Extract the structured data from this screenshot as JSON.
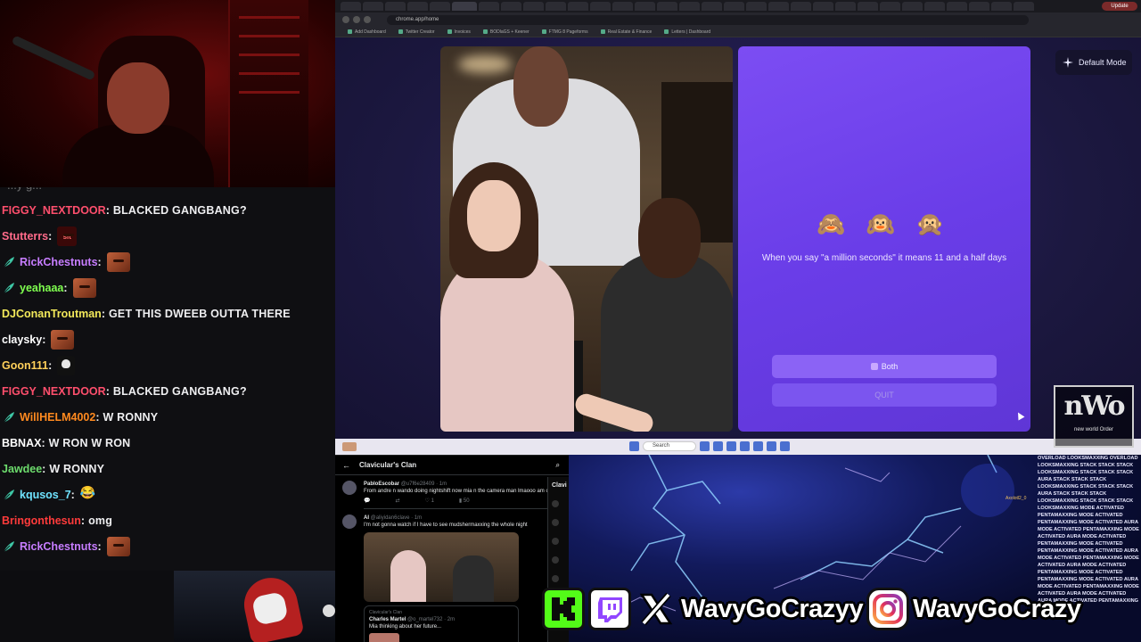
{
  "chat": {
    "cut_text": "...y g...",
    "messages": [
      {
        "user": "FIGGY_NEXTDOOR",
        "color": "#ff4f6d",
        "badge": "",
        "text": "BLACKED GANGBANG?",
        "emote": ""
      },
      {
        "user": "Stutterrs",
        "color": "#ff6b8a",
        "badge": "",
        "text": "",
        "emote": "sit"
      },
      {
        "user": "RickChestnuts",
        "color": "#c77dff",
        "badge": "feather",
        "text": "",
        "emote": "face"
      },
      {
        "user": "yeahaaa",
        "color": "#7fff4f",
        "badge": "feather",
        "text": "",
        "emote": "face"
      },
      {
        "user": "DJConanTroutman",
        "color": "#f2e85a",
        "badge": "",
        "text": "GET THIS DWEEB OUTTA THERE",
        "emote": ""
      },
      {
        "user": "claysky",
        "color": "#ffffff",
        "badge": "",
        "text": "",
        "emote": "face"
      },
      {
        "user": "Goon111",
        "color": "#ffd05a",
        "badge": "",
        "text": "",
        "emote": "skull"
      },
      {
        "user": "FIGGY_NEXTDOOR",
        "color": "#ff4f6d",
        "badge": "",
        "text": "BLACKED GANGBANG?",
        "emote": ""
      },
      {
        "user": "WillHELM4002",
        "color": "#ff8a1f",
        "badge": "feather",
        "text": "W RONNY",
        "emote": ""
      },
      {
        "user": "BBNAX",
        "color": "#ffffff",
        "badge": "",
        "text": "W RON W RON",
        "emote": ""
      },
      {
        "user": "Jawdee",
        "color": "#6ddc6d",
        "badge": "",
        "text": "W RONNY",
        "emote": ""
      },
      {
        "user": "kqusos_7",
        "color": "#6fe3ff",
        "badge": "feather",
        "text": "",
        "emote": "joy"
      },
      {
        "user": "Bringonthesun",
        "color": "#ff3b3b",
        "badge": "",
        "text": "omg",
        "emote": ""
      },
      {
        "user": "RickChestnuts",
        "color": "#c77dff",
        "badge": "feather",
        "text": "",
        "emote": "face"
      }
    ]
  },
  "browser": {
    "url": "chrome.app/home",
    "profile": "Update",
    "bookmarks": [
      "Add Dashboard",
      "Twitter Creator",
      "Invoices",
      "BODlaGS + Keener",
      "FTMG 8 Pageforms",
      "Real Estate & Finance",
      "Letters | Dashboard"
    ],
    "mode_label": "Default Mode",
    "statement": "When you say \"a million seconds\" it means 11 and a half days",
    "emojis": "🙈 🙉 🙊",
    "both_label": "Both",
    "quit_label": "QUIT",
    "taskbar_search": "Search",
    "logo_text": "nWo",
    "logo_sub": "new world Order"
  },
  "xfeed": {
    "title": "Clavicular's Clan",
    "side_title": "Clavi",
    "posts": [
      {
        "name": "PabloEscobar",
        "handle": "@u7f6e28409 · 1m",
        "text": "From andre n wando doing nightshift now mia n the camera man lmaooo am out",
        "replies": "",
        "reposts": "",
        "likes": "1",
        "views": "50"
      },
      {
        "name": "AI",
        "handle": "@aliyidan6clave · 1m",
        "text": "I'm not gonna watch if I have to see mudshermaxxing the whole night"
      }
    ],
    "quote": {
      "head": "Clavicular's Clan",
      "name": "Charles Martel",
      "handle": "@o_martel732 · 2m",
      "text": "Mia thinking about her future..."
    }
  },
  "overlay": {
    "ticker": "OVERLOAD LOOKSMAXXING OVERLOAD LOOKSMAXXING STACK STACK STACK LOOKSMAXXING STACK STACK STACK AURA STACK STACK STACK LOOKSMAXXING STACK STACK STACK AURA STACK STACK STACK LOOKSMAXXING STACK STACK STACK LOOKSMAXXING MODE ACTIVATED PENTAMAXXING MODE ACTIVATED PENTAMAXXING MODE ACTIVATED AURA MODE ACTIVATED PENTAMAXXING MODE ACTIVATED AURA MODE ACTIVATED PENTAMAXXING MODE ACTIVATED PENTAMAXXING MODE ACTIVATED AURA MODE ACTIVATED PENTAMAXXING MODE ACTIVATED AURA MODE ACTIVATED PENTAMAXXING MODE ACTIVATED PENTAMAXXING MODE ACTIVATED AURA MODE ACTIVATED PENTAMAXXING MODE ACTIVATED AURA MODE ACTIVATED AURA MODE ACTIVATED PENTAMAXXING MODE ACTIVATED",
    "alert_name": "Axolotl2_0",
    "handle_x": "WavyGoCrazyy",
    "handle_ig": "WavyGoCrazy",
    "kick_color": "#53fc18",
    "twitch_color": "#9146ff"
  }
}
